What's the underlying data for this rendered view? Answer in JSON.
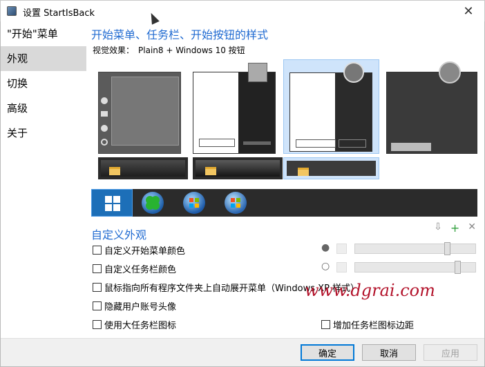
{
  "window": {
    "title": "设置 StartIsBack",
    "close_glyph": "✕"
  },
  "sidebar": {
    "items": [
      {
        "label": "\"开始\"菜单",
        "active": false
      },
      {
        "label": "外观",
        "active": true
      },
      {
        "label": "切换",
        "active": false
      },
      {
        "label": "高级",
        "active": false
      },
      {
        "label": "关于",
        "active": false
      }
    ]
  },
  "main": {
    "heading": "开始菜单、任务栏、开始按钮的样式",
    "visual_effect_label": "视觉效果：",
    "visual_effect_value": "Plain8 + Windows 10 按钮",
    "styles": [
      {
        "name": "windows-10-tiles",
        "selected": false
      },
      {
        "name": "classic-light",
        "selected": false
      },
      {
        "name": "plain8",
        "selected": true
      },
      {
        "name": "dark-flat",
        "selected": false
      }
    ],
    "taskbar_styles": [
      {
        "name": "taskbar-a",
        "selected": false
      },
      {
        "name": "taskbar-b",
        "selected": false
      },
      {
        "name": "taskbar-c",
        "selected": true
      }
    ],
    "start_buttons": [
      {
        "name": "windows-10-button",
        "selected": true
      },
      {
        "name": "clover-orb",
        "selected": false
      },
      {
        "name": "windows-7-orb",
        "selected": false
      },
      {
        "name": "windows-8-orb",
        "selected": false
      }
    ]
  },
  "customize": {
    "title": "自定义外观",
    "tools": {
      "download": "⇩",
      "add": "+",
      "remove": "✕"
    },
    "options": [
      {
        "label": "自定义开始菜单颜色",
        "checked": false
      },
      {
        "label": "自定义任务栏颜色",
        "checked": false
      },
      {
        "label": "鼠标指向所有程序文件夹上自动展开菜单（Windows XP 样式）",
        "checked": false
      },
      {
        "label": "隐藏用户账号头像",
        "checked": false
      },
      {
        "label": "使用大任务栏图标",
        "checked": false
      },
      {
        "label": "增加任务栏图标边距",
        "checked": false
      }
    ],
    "sliders": {
      "menu_color_level": 0.78,
      "taskbar_color_level": 0.87
    }
  },
  "watermark": "www.dgrai.com",
  "footer": {
    "ok": "确定",
    "cancel": "取消",
    "apply": "应用"
  },
  "colors": {
    "accent_heading": "#1f6ad1",
    "selection_bg": "#cfe4fb",
    "watermark": "#b3122a"
  }
}
